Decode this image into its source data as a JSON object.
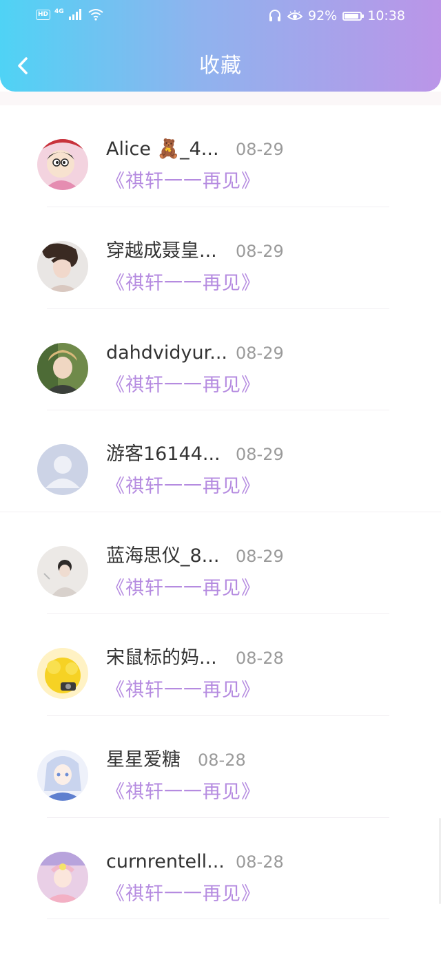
{
  "status_bar": {
    "hd": "HD",
    "network": "4G",
    "battery_percent": "92%",
    "battery_level": 0.92,
    "time": "10:38"
  },
  "header": {
    "title": "收藏",
    "back_icon": "chevron-left-icon",
    "gradient": [
      "#4fd3f5",
      "#bb95e8"
    ]
  },
  "favorites": [
    {
      "name": "Alice 🧸_4...",
      "date": "08-29",
      "title": "《祺轩一一再见》"
    },
    {
      "name": "穿越成聂皇...",
      "date": "08-29",
      "title": "《祺轩一一再见》"
    },
    {
      "name": "dahdvidyur...",
      "date": "08-29",
      "title": "《祺轩一一再见》"
    },
    {
      "name": "游客16144...",
      "date": "08-29",
      "title": "《祺轩一一再见》"
    },
    {
      "name": "蓝海思仪_8...",
      "date": "08-29",
      "title": "《祺轩一一再见》"
    },
    {
      "name": "宋鼠标的妈...",
      "date": "08-28",
      "title": "《祺轩一一再见》"
    },
    {
      "name": "星星爱糖",
      "date": "08-28",
      "title": "《祺轩一一再见》"
    },
    {
      "name": "curnrentell...",
      "date": "08-28",
      "title": "《祺轩一一再见》"
    }
  ],
  "colors": {
    "title_purple": "#b58be0",
    "name_text": "#333333",
    "date_text": "#9a9a9a"
  }
}
